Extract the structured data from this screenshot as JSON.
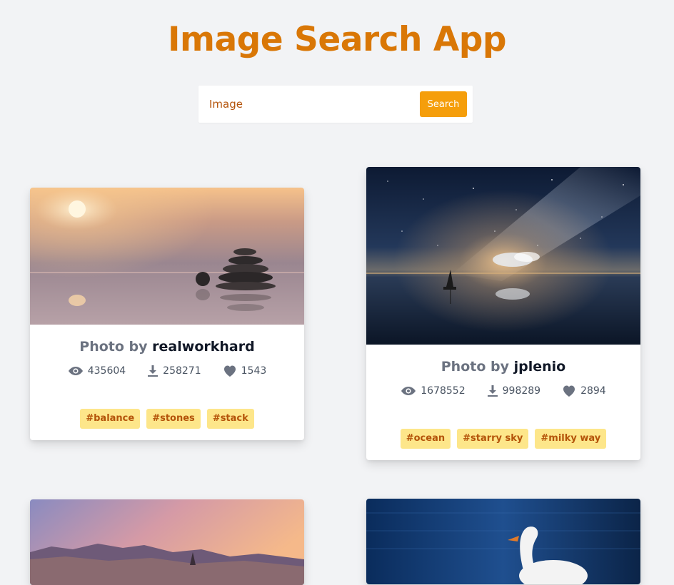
{
  "header": {
    "title": "Image Search App"
  },
  "search": {
    "value": "Image",
    "button_label": "Search"
  },
  "cards": [
    {
      "photo_by_label": "Photo by",
      "author": "realworkhard",
      "views": "435604",
      "downloads": "258271",
      "likes": "1543",
      "tags": [
        "#balance",
        "#stones",
        "#stack"
      ],
      "image_description": "stacked pebbles at sunset over misty water"
    },
    {
      "photo_by_label": "Photo by",
      "author": "jplenio",
      "views": "1678552",
      "downloads": "998289",
      "likes": "2894",
      "tags": [
        "#ocean",
        "#starry sky",
        "#milky way"
      ],
      "image_description": "sailboat under milky way starry night sky"
    }
  ],
  "icons": {
    "views": "eye-icon",
    "downloads": "download-icon",
    "likes": "heart-icon"
  },
  "colors": {
    "accent": "#d97706",
    "button": "#f59e0b",
    "tag_bg": "#fde68a",
    "tag_text": "#b45309"
  }
}
